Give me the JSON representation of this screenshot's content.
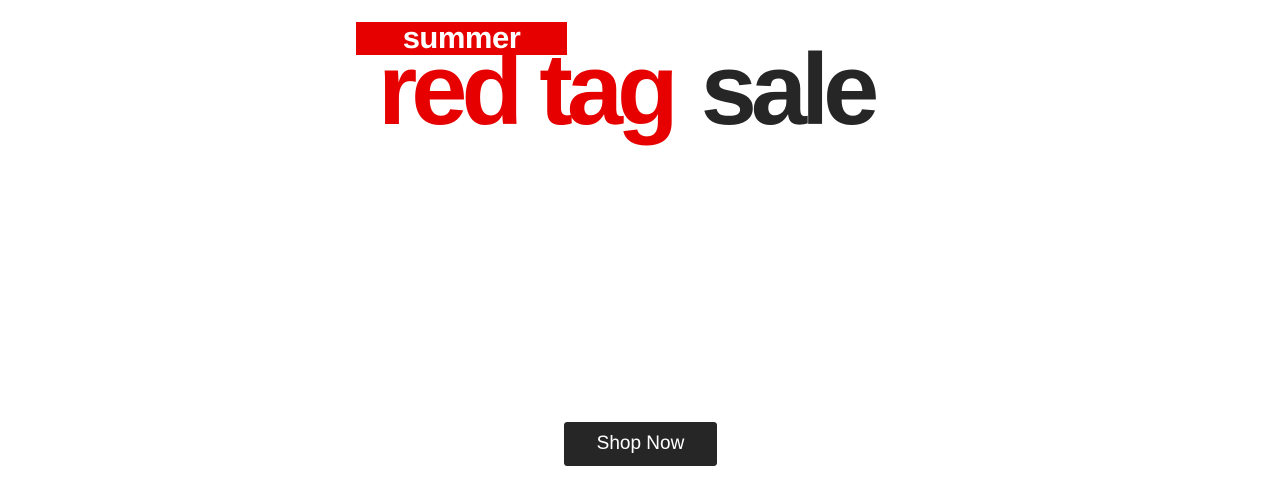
{
  "banner": {
    "tag_label": "summer",
    "headline_red": "red tag",
    "headline_dark": "sale",
    "cta_label": "Shop Now"
  },
  "colors": {
    "brand_red": "#e60000",
    "dark": "#262626",
    "background": "#ffffff",
    "button_text": "#ffffff"
  }
}
